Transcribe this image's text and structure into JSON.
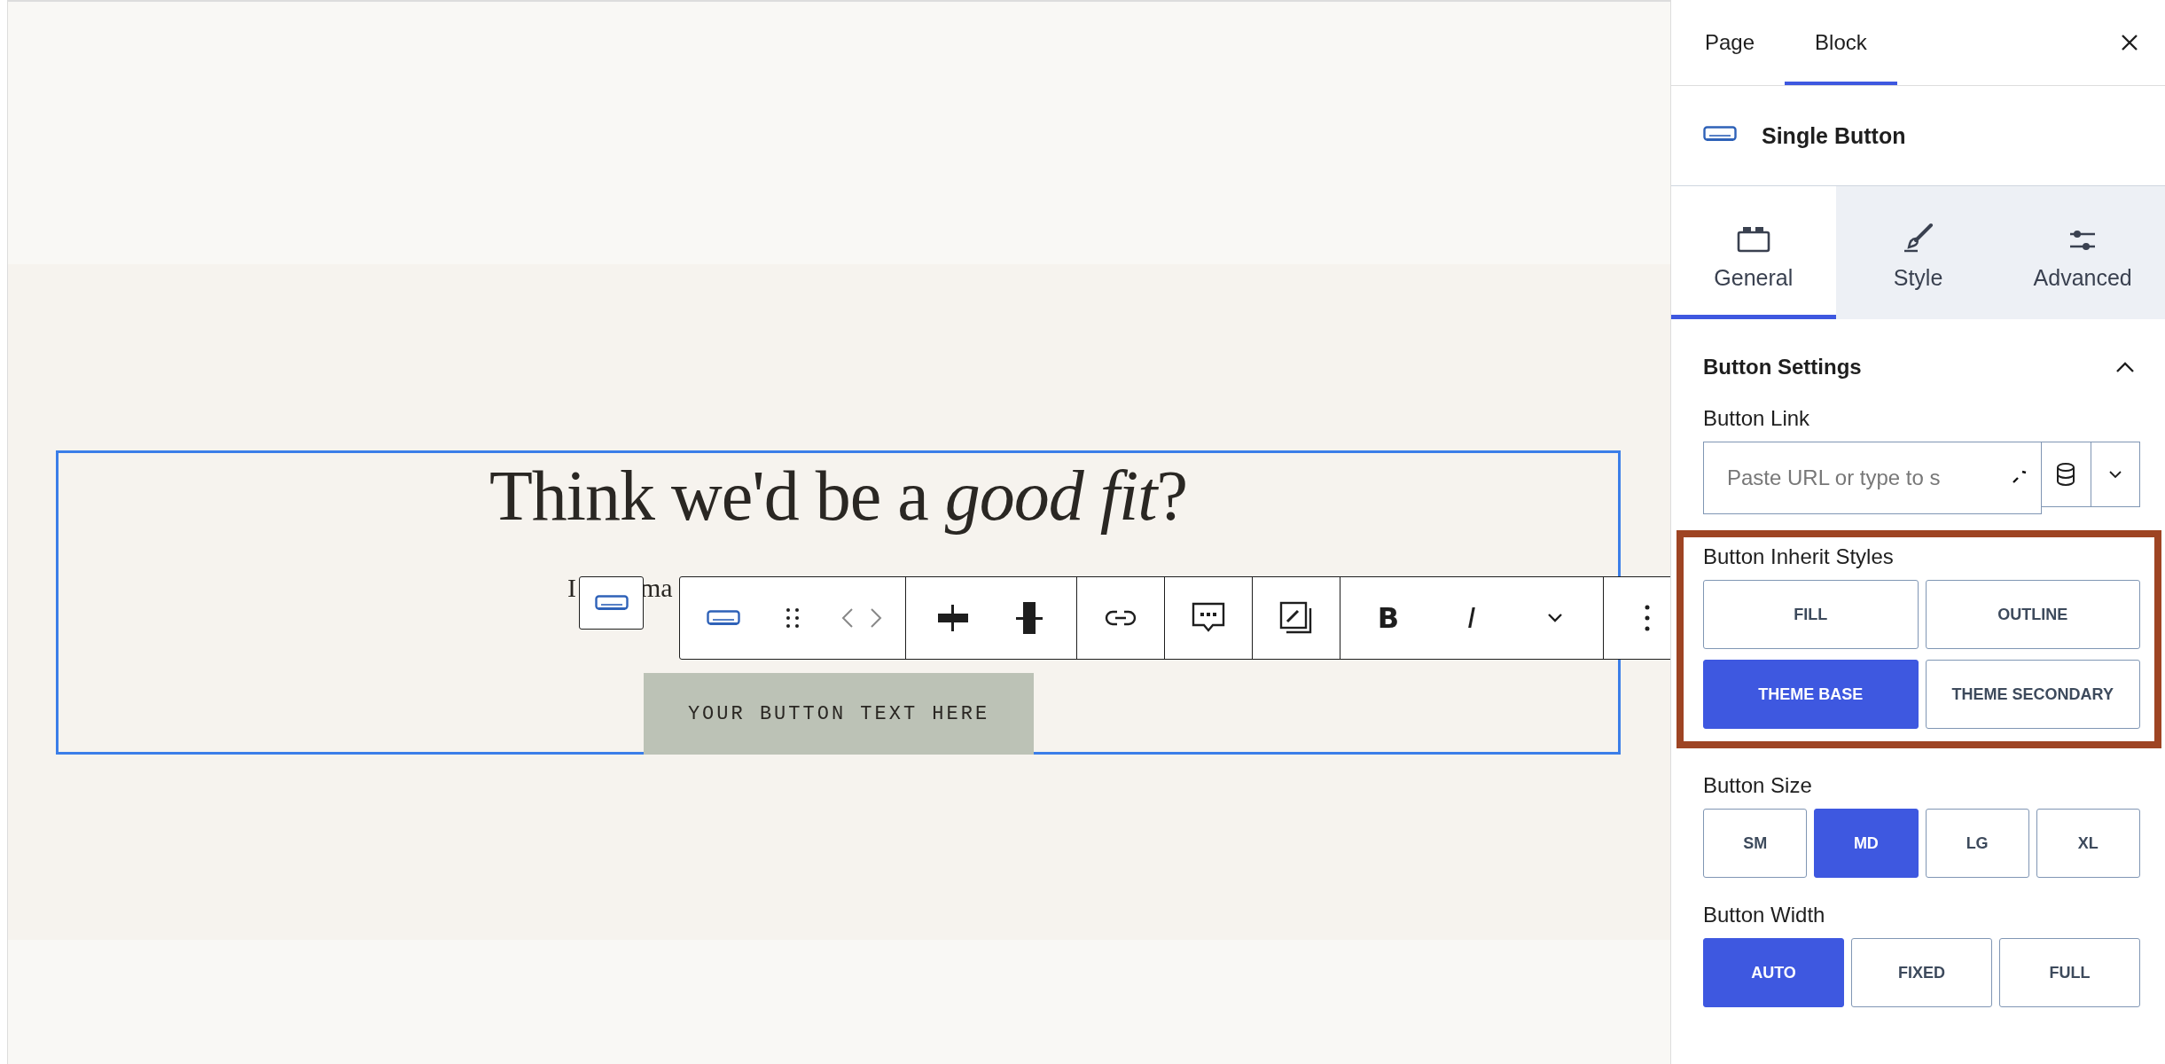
{
  "canvas": {
    "heading": "Think we'd be a *good fit*?",
    "paragraph_parts": [
      "I",
      "ma"
    ],
    "button_text": "YOUR BUTTON TEXT HERE",
    "selected": true
  },
  "toolbar": [
    [
      {
        "kind": "block"
      },
      {
        "kind": "drag"
      },
      {
        "kind": "move"
      }
    ],
    [
      {
        "kind": "align-left"
      },
      {
        "kind": "align-center"
      }
    ],
    [
      {
        "kind": "link"
      }
    ],
    [
      {
        "kind": "comment"
      }
    ],
    [
      {
        "kind": "image"
      }
    ],
    [
      {
        "kind": "bold",
        "label": "B"
      },
      {
        "kind": "italic",
        "label": "I"
      },
      {
        "kind": "more"
      }
    ],
    [
      {
        "kind": "options"
      }
    ]
  ],
  "sidebar_tabs": [
    {
      "label": "Page",
      "selected": false
    },
    {
      "label": "Block",
      "selected": true
    }
  ],
  "block": {
    "name": "Single Button"
  },
  "panel_tabs": [
    {
      "kind": "general",
      "label": "General",
      "selected": true
    },
    {
      "kind": "style",
      "label": "Style",
      "selected": false
    },
    {
      "kind": "advanced",
      "label": "Advanced",
      "selected": false
    }
  ],
  "section": {
    "title": "Button Settings",
    "expanded": true
  },
  "link": {
    "label": "Button Link",
    "placeholder": "Paste URL or type to s"
  },
  "groups": [
    {
      "label": "Button Inherit Styles",
      "highlighted": true,
      "options": [
        {
          "label": "FILL",
          "selected": false
        },
        {
          "label": "OUTLINE",
          "selected": false
        },
        {
          "label": "THEME BASE",
          "selected": true
        },
        {
          "label": "THEME SECONDARY",
          "selected": false
        }
      ]
    },
    {
      "label": "Button Size",
      "highlighted": false,
      "options": [
        {
          "label": "SM",
          "selected": false
        },
        {
          "label": "MD",
          "selected": true
        },
        {
          "label": "LG",
          "selected": false
        },
        {
          "label": "XL",
          "selected": false
        }
      ]
    },
    {
      "label": "Button Width",
      "highlighted": false,
      "options": [
        {
          "label": "AUTO",
          "selected": true
        },
        {
          "label": "FIXED",
          "selected": false
        },
        {
          "label": "FULL",
          "selected": false
        }
      ]
    }
  ]
}
